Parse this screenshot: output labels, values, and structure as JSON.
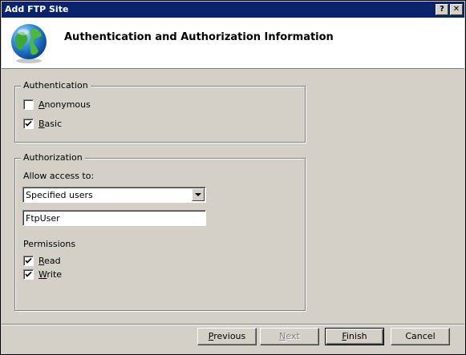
{
  "window": {
    "title": "Add FTP Site",
    "help_button": "?",
    "close_button": "✕"
  },
  "header": {
    "title": "Authentication and Authorization Information",
    "icon": "globe-icon"
  },
  "authentication": {
    "legend": "Authentication",
    "anonymous": {
      "prefix": "",
      "mnemonic": "A",
      "rest": "nonymous",
      "checked": false
    },
    "basic": {
      "prefix": "",
      "mnemonic": "B",
      "rest": "asic",
      "checked": true
    }
  },
  "authorization": {
    "legend": "Authorization",
    "allow_access_label": "Allow access to:",
    "allow_access_value": "Specified users",
    "users_value": "FtpUser",
    "permissions_label": "Permissions",
    "read": {
      "prefix": "",
      "mnemonic": "R",
      "rest": "ead",
      "checked": true
    },
    "write": {
      "prefix": "",
      "mnemonic": "W",
      "rest": "rite",
      "checked": true
    }
  },
  "buttons": {
    "previous": {
      "mnemonic": "P",
      "rest": "revious"
    },
    "next": {
      "mnemonic": "N",
      "rest": "ext"
    },
    "finish": {
      "mnemonic": "F",
      "rest": "inish"
    },
    "cancel": "Cancel"
  },
  "colors": {
    "titlebar": "#0a246a",
    "face": "#d4d0c8",
    "header_bg": "#ffffff"
  }
}
